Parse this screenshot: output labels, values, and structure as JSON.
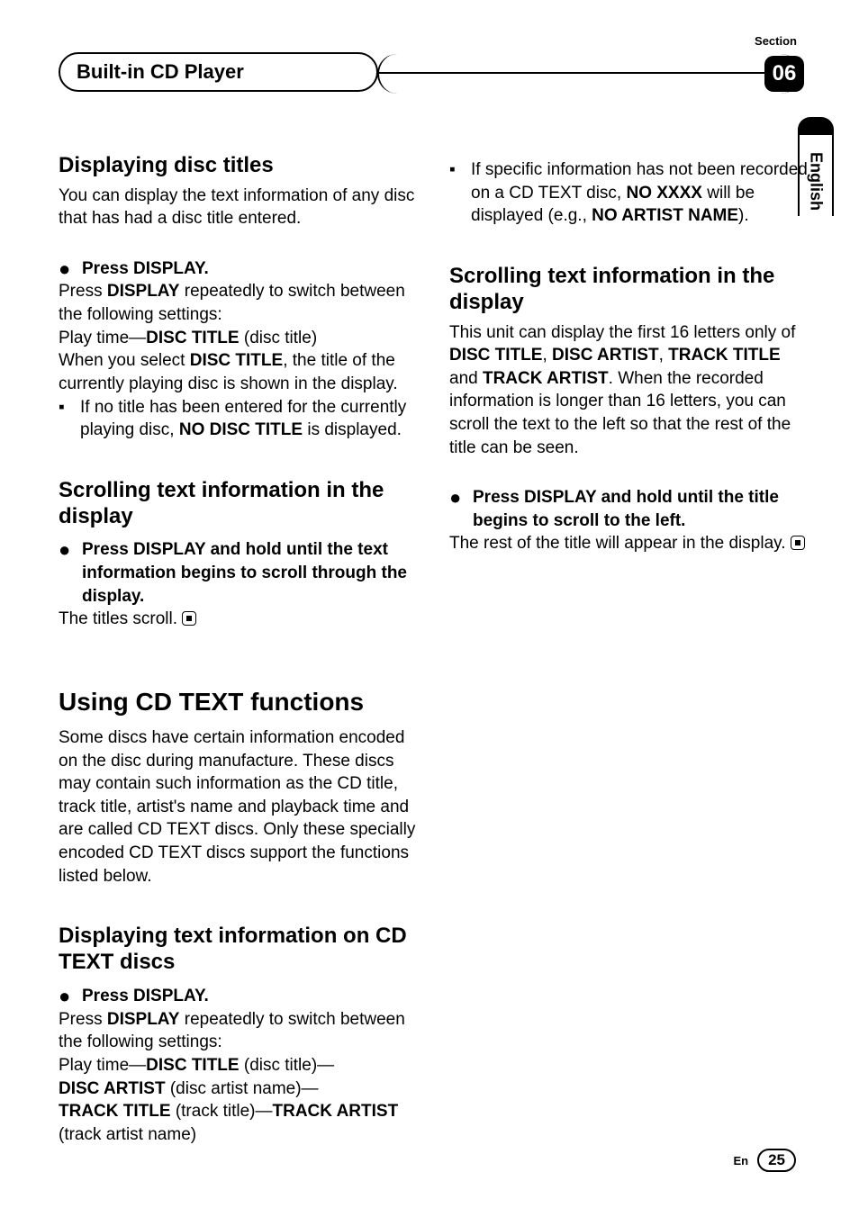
{
  "header": {
    "title": "Built-in CD Player",
    "section_label": "Section",
    "section_number": "06"
  },
  "side_tab": {
    "language": "English"
  },
  "left": {
    "s1": {
      "heading": "Displaying disc titles",
      "intro": "You can display the text information of any disc that has had a disc title entered.",
      "step": "Press DISPLAY.",
      "body1a": "Press ",
      "body1b": "DISPLAY",
      "body1c": " repeatedly to switch between the following settings:",
      "body2a": "Play time—",
      "body2b": "DISC TITLE",
      "body2c": " (disc title)",
      "body3a": "When you select ",
      "body3b": "DISC TITLE",
      "body3c": ", the title of the currently playing disc is shown in the display.",
      "note1a": "If no title has been entered for the currently playing disc, ",
      "note1b": "NO DISC TITLE",
      "note1c": " is displayed."
    },
    "s2": {
      "heading": "Scrolling text information in the display",
      "step": "Press DISPLAY and hold until the text information begins to scroll through the display.",
      "body": "The titles scroll."
    },
    "s3": {
      "heading": "Using CD TEXT functions",
      "intro": "Some discs have certain information encoded on the disc during manufacture. These discs may contain such information as the CD title, track title, artist's name and playback time and are called CD TEXT discs. Only these specially encoded CD TEXT discs support the functions listed below."
    },
    "s4": {
      "heading": "Displaying text information on CD TEXT discs",
      "step": "Press DISPLAY.",
      "body1a": "Press ",
      "body1b": "DISPLAY",
      "body1c": " repeatedly to switch between the following settings:",
      "opt1a": "Play time—",
      "opt1b": "DISC TITLE",
      "opt1c": " (disc title)—",
      "opt2a": "DISC ARTIST",
      "opt2b": " (disc artist name)—",
      "opt3a": "TRACK TITLE",
      "opt3b": " (track title)—",
      "opt3c": "TRACK ARTIST",
      "opt4": "(track artist name)"
    }
  },
  "right": {
    "note1a": "If specific information has not been recorded on a CD TEXT disc, ",
    "note1b": "NO XXXX",
    "note1c": " will be displayed (e.g., ",
    "note1d": "NO ARTIST NAME",
    "note1e": ").",
    "s1": {
      "heading": "Scrolling text information in the display",
      "intro1": "This unit can display the first 16 letters only of ",
      "b1": "DISC TITLE",
      "sep1": ", ",
      "b2": "DISC ARTIST",
      "sep2": ", ",
      "b3": "TRACK TITLE",
      "sep3": " and ",
      "b4": "TRACK ARTIST",
      "intro2": ". When the recorded information is longer than 16 letters, you can scroll the text to the left so that the rest of the title can be seen.",
      "step": "Press DISPLAY and hold until the title begins to scroll to the left.",
      "body": "The rest of the title will appear in the display."
    }
  },
  "footer": {
    "lang_code": "En",
    "page": "25"
  }
}
